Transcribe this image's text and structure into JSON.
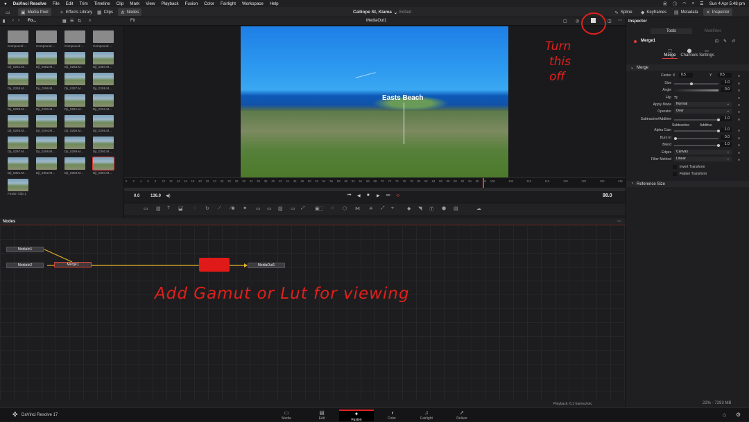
{
  "menubar": {
    "app": "DaVinci Resolve",
    "items": [
      "File",
      "Edit",
      "Trim",
      "Timeline",
      "Clip",
      "Mark",
      "View",
      "Playback",
      "Fusion",
      "Color",
      "Fairlight",
      "Workspace",
      "Help"
    ],
    "clock": "Sun 4 Apr  5:48 pm"
  },
  "toolbar": {
    "media_pool": "Media Pool",
    "effects_library": "Effects Library",
    "clips": "Clips",
    "nodes": "Nodes",
    "project_title": "Calliope St, Kiama",
    "project_state": "Edited",
    "spline": "Spline",
    "keyframes": "Keyframes",
    "metadata": "Metadata",
    "inspector": "Inspector"
  },
  "subbar": {
    "folder": "Fo...",
    "fit": "Fit",
    "viewer_name": "MediaOut1"
  },
  "media_pool": {
    "clips": [
      {
        "label": "Compound ...",
        "kind": "comp"
      },
      {
        "label": "Compound ...",
        "kind": "comp"
      },
      {
        "label": "Compound ...",
        "kind": "comp"
      },
      {
        "label": "Compound ...",
        "kind": "comp"
      },
      {
        "label": "Dji_0281.M...",
        "kind": "clip"
      },
      {
        "label": "Dji_0282.M...",
        "kind": "clip"
      },
      {
        "label": "Dji_0283.M...",
        "kind": "clip"
      },
      {
        "label": "Dji_0284.M...",
        "kind": "clip"
      },
      {
        "label": "Dji_0285.M...",
        "kind": "clip"
      },
      {
        "label": "Dji_0286.M...",
        "kind": "clip"
      },
      {
        "label": "Dji_0287.M...",
        "kind": "clip"
      },
      {
        "label": "Dji_0288.M...",
        "kind": "clip"
      },
      {
        "label": "Dji_0289.M...",
        "kind": "clip"
      },
      {
        "label": "Dji_0290.M...",
        "kind": "clip"
      },
      {
        "label": "Dji_0291.M...",
        "kind": "clip"
      },
      {
        "label": "Dji_0292.M...",
        "kind": "clip"
      },
      {
        "label": "Dji_0293.M...",
        "kind": "clip"
      },
      {
        "label": "Dji_0294.M...",
        "kind": "clip"
      },
      {
        "label": "Dji_0295.M...",
        "kind": "clip"
      },
      {
        "label": "Dji_0296.M...",
        "kind": "clip"
      },
      {
        "label": "Dji_0297.M...",
        "kind": "clip"
      },
      {
        "label": "Dji_0298.M...",
        "kind": "clip"
      },
      {
        "label": "Dji_0299.M...",
        "kind": "clip"
      },
      {
        "label": "Dji_0300.M...",
        "kind": "clip"
      },
      {
        "label": "Dji_0301.M...",
        "kind": "clip"
      },
      {
        "label": "Dji_0302.M...",
        "kind": "clip"
      },
      {
        "label": "Dji_0303.M...",
        "kind": "clip"
      },
      {
        "label": "Dji_0304.M...",
        "kind": "clip",
        "selected": true
      },
      {
        "label": "Fusion Clip 1",
        "kind": "clip"
      }
    ]
  },
  "viewer": {
    "overlay_text": "Easts Beach"
  },
  "ruler": {
    "ticks": [
      "0",
      "2",
      "4",
      "6",
      "8",
      "10",
      "12",
      "14",
      "16",
      "18",
      "20",
      "22",
      "24",
      "26",
      "28",
      "30",
      "32",
      "34",
      "36",
      "38",
      "40",
      "42",
      "44",
      "46",
      "48",
      "50",
      "52",
      "54",
      "56",
      "58",
      "60",
      "62",
      "64",
      "66",
      "68",
      "70",
      "72",
      "74",
      "76",
      "78",
      "80",
      "82",
      "84",
      "86",
      "88",
      "90",
      "92",
      "94",
      "96",
      "98",
      "100",
      "105",
      "110",
      "115",
      "120",
      "125",
      "130",
      "135"
    ],
    "playhead_frame": 98
  },
  "transport": {
    "start": "0.0",
    "end": "136.0",
    "current": "98.0"
  },
  "nodes_panel": {
    "title": "Nodes",
    "nodes": {
      "media_in1": "MediaIn1",
      "media_in2": "MediaIn2",
      "merge1": "Merge1",
      "media_out1": "MediaOut1"
    }
  },
  "status": {
    "playback": "Playback: 6.1 frames/sec",
    "memory": "22% - 7293 MB"
  },
  "inspector": {
    "title": "Inspector",
    "tab_tools": "Tools",
    "tab_modifiers": "Modifiers",
    "node_name": "Merge1",
    "subtabs": [
      "Merge",
      "Channels",
      "Settings"
    ],
    "section_merge": "Merge",
    "section_reference": "Reference Size",
    "rows": {
      "center_label": "Center",
      "center_x_label": "X",
      "center_x": "0.5",
      "center_y_label": "Y",
      "center_y": "0.5",
      "size_label": "Size",
      "size": "1.0",
      "angle_label": "Angle",
      "angle": "0.0",
      "flip_label": "Flip",
      "apply_mode_label": "Apply Mode",
      "apply_mode": "Normal",
      "operator_label": "Operator",
      "operator": "Over",
      "subadd_label": "Subtractive/Additive",
      "subadd": "1.0",
      "subtractive": "Subtractive",
      "additive": "Additive",
      "alpha_gain_label": "Alpha Gain",
      "alpha_gain": "1.0",
      "burn_in_label": "Burn In",
      "burn_in": "0.0",
      "blend_label": "Blend",
      "blend": "1.0",
      "edges_label": "Edges",
      "edges": "Canvas",
      "filter_label": "Filter Method",
      "filter": "Linear",
      "invert_transform": "Invert Transform",
      "flatten_transform": "Flatten Transform"
    }
  },
  "pages": [
    {
      "label": "Media",
      "icon": "media-page-icon",
      "glyph": "▭"
    },
    {
      "label": "Edit",
      "icon": "edit-page-icon",
      "glyph": "▤"
    },
    {
      "label": "Fusion",
      "icon": "fusion-page-icon",
      "glyph": "✦",
      "active": true
    },
    {
      "label": "Color",
      "icon": "color-page-icon",
      "glyph": "◑"
    },
    {
      "label": "Fairlight",
      "icon": "fairlight-page-icon",
      "glyph": "♫"
    },
    {
      "label": "Deliver",
      "icon": "deliver-page-icon",
      "glyph": "➚"
    }
  ],
  "brand": "DaVinci Resolve 17",
  "annotations": {
    "top_right": [
      "Turn",
      "this",
      "off"
    ],
    "bottom": "Add Gamut or Lut for viewing"
  },
  "colors": {
    "accent": "#e33c3c",
    "link_line": "#e8b52a",
    "annotation": "#e0201c"
  }
}
